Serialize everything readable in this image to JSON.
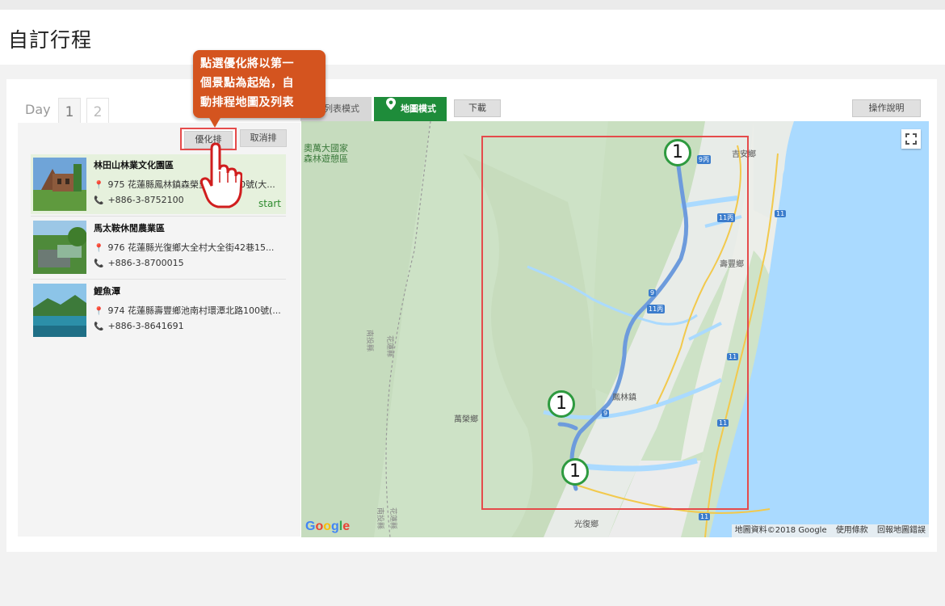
{
  "page": {
    "title": "自訂行程"
  },
  "callout": {
    "lines": [
      "點選優化將以第一",
      "個景點為起始，自",
      "動排程地圖及列表"
    ]
  },
  "days": {
    "label": "Day",
    "tabs": [
      "1",
      "2"
    ],
    "active": "1"
  },
  "sidebar": {
    "optimize_label": "優化排",
    "cancel_label": "取消排",
    "items": [
      {
        "name": "林田山林業文化園區",
        "address": "975 花蓮縣鳳林鎮森榮里林森路20號(大...",
        "phone": "+886-3-8752100",
        "start_label": "start",
        "active": true
      },
      {
        "name": "馬太鞍休閒農業區",
        "address": "976 花蓮縣光復鄉大全村大全街42巷15...",
        "phone": "+886-3-8700015",
        "active": false
      },
      {
        "name": "鯉魚潭",
        "address": "974 花蓮縣壽豐鄉池南村環潭北路100號(...",
        "phone": "+886-3-8641691",
        "active": false
      }
    ]
  },
  "toolbar": {
    "list_mode": "列表模式",
    "map_mode": "地圖模式",
    "download": "下載",
    "help": "操作說明"
  },
  "map": {
    "labels": {
      "forest": "奧萬大國家",
      "forest2": "森林遊憩區",
      "jian": "吉安鄉",
      "shoufeng": "壽豐鄉",
      "fenglin": "鳳林鎮",
      "wanrong": "萬榮鄉",
      "guangfu": "光復鄉",
      "trail1": "南投縣",
      "trail2": "花蓮縣",
      "trail3": "南投縣",
      "trail4": "花蓮縣"
    },
    "road_shields": {
      "r9a": "9丙",
      "r11a": "11丙",
      "r11b": "11",
      "r11c": "11",
      "r11d": "11",
      "r11e": "11",
      "r9b": "9",
      "r9c": "9",
      "r11f": "11丙"
    },
    "markers": [
      "1",
      "1",
      "1"
    ],
    "google": "Google",
    "footer": {
      "data": "地圖資料©2018 Google",
      "terms": "使用條款",
      "report": "回報地圖錯誤"
    }
  },
  "colors": {
    "accent_green": "#1e8c3a",
    "callout_orange": "#d4541f",
    "highlight_red": "#e54b4b",
    "route_blue": "#6d9bdc"
  }
}
